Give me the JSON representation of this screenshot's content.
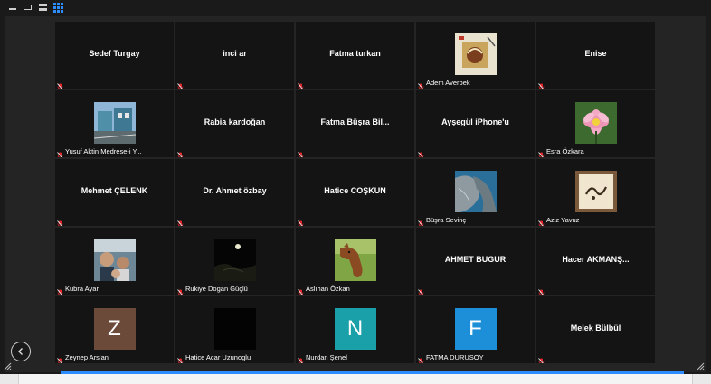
{
  "toolbar": {
    "buttons": [
      "minimize-icon",
      "speaker-view-icon",
      "filmstrip-view-icon",
      "gallery-view-icon"
    ]
  },
  "colors": {
    "accent": "#2d8cff",
    "tile_bg": "#141414",
    "muted_icon": "#e0262b",
    "avatar_z": "#6b4a3a",
    "avatar_n": "#1aa0a8",
    "avatar_f": "#1c8fd8"
  },
  "participants": [
    {
      "display": "name",
      "name": "Sedef Turgay",
      "label": ""
    },
    {
      "display": "name",
      "name": "inci ar",
      "label": ""
    },
    {
      "display": "name",
      "name": "Fatma turkan",
      "label": ""
    },
    {
      "display": "photo",
      "name": "",
      "label": "Adem Averbek",
      "photo": "calligraphy-artwork"
    },
    {
      "display": "name",
      "name": "Enise",
      "label": ""
    },
    {
      "display": "photo",
      "name": "",
      "label": "Yusuf Aktin Medrese-i Y...",
      "photo": "building-street"
    },
    {
      "display": "name",
      "name": "Rabia kardoğan",
      "label": ""
    },
    {
      "display": "name",
      "name": "Fatma Büşra Bil...",
      "label": ""
    },
    {
      "display": "name",
      "name": "Ayşegül iPhone'u",
      "label": ""
    },
    {
      "display": "photo",
      "name": "",
      "label": "Esra Özkara",
      "photo": "pink-lotus"
    },
    {
      "display": "name",
      "name": "Mehmet ÇELENK",
      "label": ""
    },
    {
      "display": "name",
      "name": "Dr. Ahmet özbay",
      "label": ""
    },
    {
      "display": "name",
      "name": "Hatice COŞKUN",
      "label": ""
    },
    {
      "display": "photo",
      "name": "",
      "label": "Büşra Sevinç",
      "photo": "coastal-rock"
    },
    {
      "display": "photo",
      "name": "",
      "label": "Aziz Yavuz",
      "photo": "framed-calligraphy"
    },
    {
      "display": "photo",
      "name": "",
      "label": "Kubra Ayar",
      "photo": "family-selfie"
    },
    {
      "display": "photo",
      "name": "",
      "label": "Rukiye Dogan Güçlü",
      "photo": "night-moon"
    },
    {
      "display": "photo",
      "name": "",
      "label": "Aslıhan Özkan",
      "photo": "horse"
    },
    {
      "display": "name",
      "name": "AHMET BUGUR",
      "label": ""
    },
    {
      "display": "name",
      "name": "Hacer  AKMANŞ...",
      "label": ""
    },
    {
      "display": "letter",
      "letter": "Z",
      "label": "Zeynep Arslan",
      "color": "#6b4a3a"
    },
    {
      "display": "photo",
      "name": "",
      "label": "Hatice Acar Uzunoglu",
      "photo": "dark-image"
    },
    {
      "display": "letter",
      "letter": "N",
      "label": "Nurdan Şenel",
      "color": "#1aa0a8"
    },
    {
      "display": "letter",
      "letter": "F",
      "label": "FATMA DURUSOY",
      "color": "#1c8fd8"
    },
    {
      "display": "name",
      "name": "Melek Bülbül",
      "label": ""
    }
  ],
  "navigation": {
    "prev_page": "chevron-left-icon"
  }
}
